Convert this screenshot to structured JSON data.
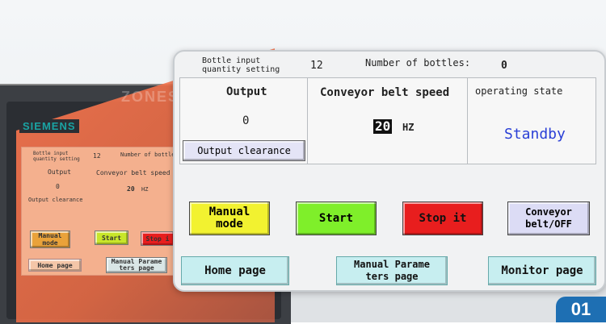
{
  "brand": "SIEMENS",
  "badge": "01",
  "watermark": "ZONESUN",
  "panel": {
    "bottle_input_label": "Bottle input\nquantity setting",
    "bottle_input_value": "12",
    "bottle_count_label": "Number of bottles:",
    "bottle_count_value": "0",
    "output_label": "Output",
    "output_value": "0",
    "output_clear_button": "Output clearance",
    "speed_label": "Conveyor belt speed",
    "speed_value": "20",
    "speed_unit": "HZ",
    "state_label": "operating state",
    "state_value": "Standby",
    "buttons": {
      "manual": "Manual\nmode",
      "start": "Start",
      "stop": "Stop it",
      "conveyor": "Conveyor\nbelt/OFF"
    },
    "nav": {
      "home": "Home page",
      "manual_params": "Manual Parame\nters page",
      "monitor": "Monitor page"
    }
  },
  "mini": {
    "bottle_input_label": "Bottle input\nquantity setting",
    "bottle_input_value": "12",
    "bottle_count_label": "Number of bottles",
    "output_label": "Output",
    "output_value": "0",
    "output_clear_button": "Output clearance",
    "speed_label": "Conveyor belt speed",
    "speed_value": "20",
    "speed_unit": "HZ",
    "manual": "Manual\nmode",
    "start": "Start",
    "stop": "Stop i",
    "home": "Home page",
    "manual_params": "Manual Parame\nters page"
  },
  "colors": {
    "manual": "#f2f230",
    "start": "#7fef2a",
    "stop": "#e81e1e",
    "conveyor": "#dcdcf5",
    "nav": "#c7eef0",
    "state_text": "#2a3fd6",
    "badge": "#1e6fb3"
  }
}
